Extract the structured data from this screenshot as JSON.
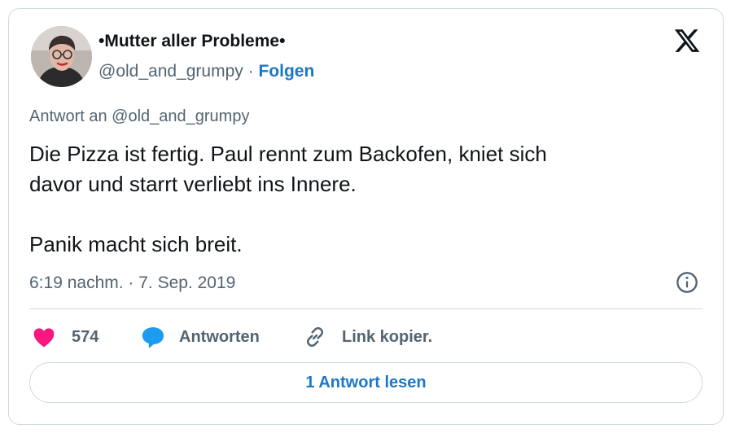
{
  "author": {
    "display_name": "•Mutter aller Probleme•",
    "handle": "@old_and_grumpy",
    "separator": "·",
    "follow_label": "Folgen"
  },
  "reply_to": "Antwort an @old_and_grumpy",
  "tweet": {
    "line1": "Die Pizza ist fertig. Paul rennt zum Backofen, kniet sich",
    "line2": "davor und starrt verliebt ins Innere.",
    "line3": "Panik macht sich breit."
  },
  "timestamp": "6:19 nachm. · 7. Sep. 2019",
  "actions": {
    "like_count": "574",
    "reply_label": "Antworten",
    "copy_label": "Link kopier."
  },
  "read_replies_label": "1 Antwort lesen",
  "icons": {
    "logo": "x-logo-icon",
    "info": "info-icon",
    "like": "heart-icon",
    "reply": "speech-bubble-icon",
    "copy": "link-icon"
  },
  "colors": {
    "link_blue": "#1d77c8",
    "heart_pink": "#f91880",
    "reply_blue": "#1d9bf0",
    "muted_text": "#536471",
    "border": "#cfd9de"
  }
}
